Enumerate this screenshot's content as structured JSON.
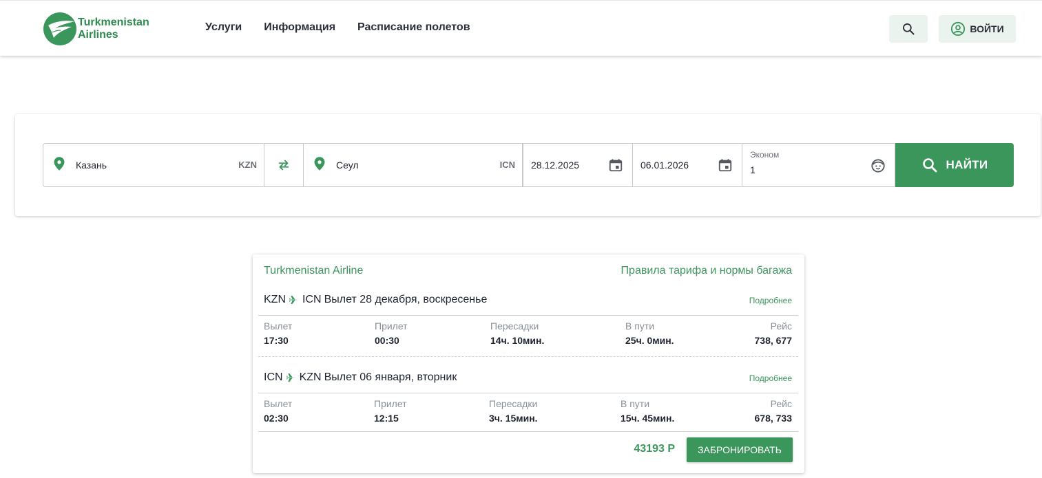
{
  "header": {
    "logo_line1": "Turkmenistan",
    "logo_line2": "Airlines",
    "nav": [
      "Услуги",
      "Информация",
      "Расписание полетов"
    ],
    "login_label": "ВОЙТИ",
    "icons": {
      "search": "search-icon",
      "login": "account-circle-icon"
    }
  },
  "search": {
    "from_city": "Казань",
    "from_code": "KZN",
    "to_city": "Сеул",
    "to_code": "ICN",
    "date_depart": "28.12.2025",
    "date_return": "06.01.2026",
    "class_label": "Эконом",
    "passengers": "1",
    "find_label": "НАЙТИ"
  },
  "result": {
    "airline": "Turkmenistan Airline",
    "rules_link": "Правила тарифа и нормы багажа",
    "more_label": "Подробнее",
    "columns": [
      "Вылет",
      "Прилет",
      "Пересадки",
      "В пути",
      "Рейс"
    ],
    "legs": [
      {
        "from": "KZN",
        "to": "ICN",
        "title": "Вылет 28 декабря, воскресенье",
        "values": [
          "17:30",
          "00:30",
          "14ч. 10мин.",
          "25ч. 0мин.",
          "738, 677"
        ]
      },
      {
        "from": "ICN",
        "to": "KZN",
        "title": "Вылет 06 января, вторник",
        "values": [
          "02:30",
          "12:15",
          "3ч. 15мин.",
          "15ч. 45мин.",
          "678, 733"
        ]
      }
    ],
    "price": "43193 Р",
    "book_label": "ЗАБРОНИРОВАТЬ"
  },
  "colors": {
    "accent": "#3a965b",
    "accent_light": "#eaf3ee",
    "text": "#1f2430",
    "muted": "#8a8f97"
  }
}
